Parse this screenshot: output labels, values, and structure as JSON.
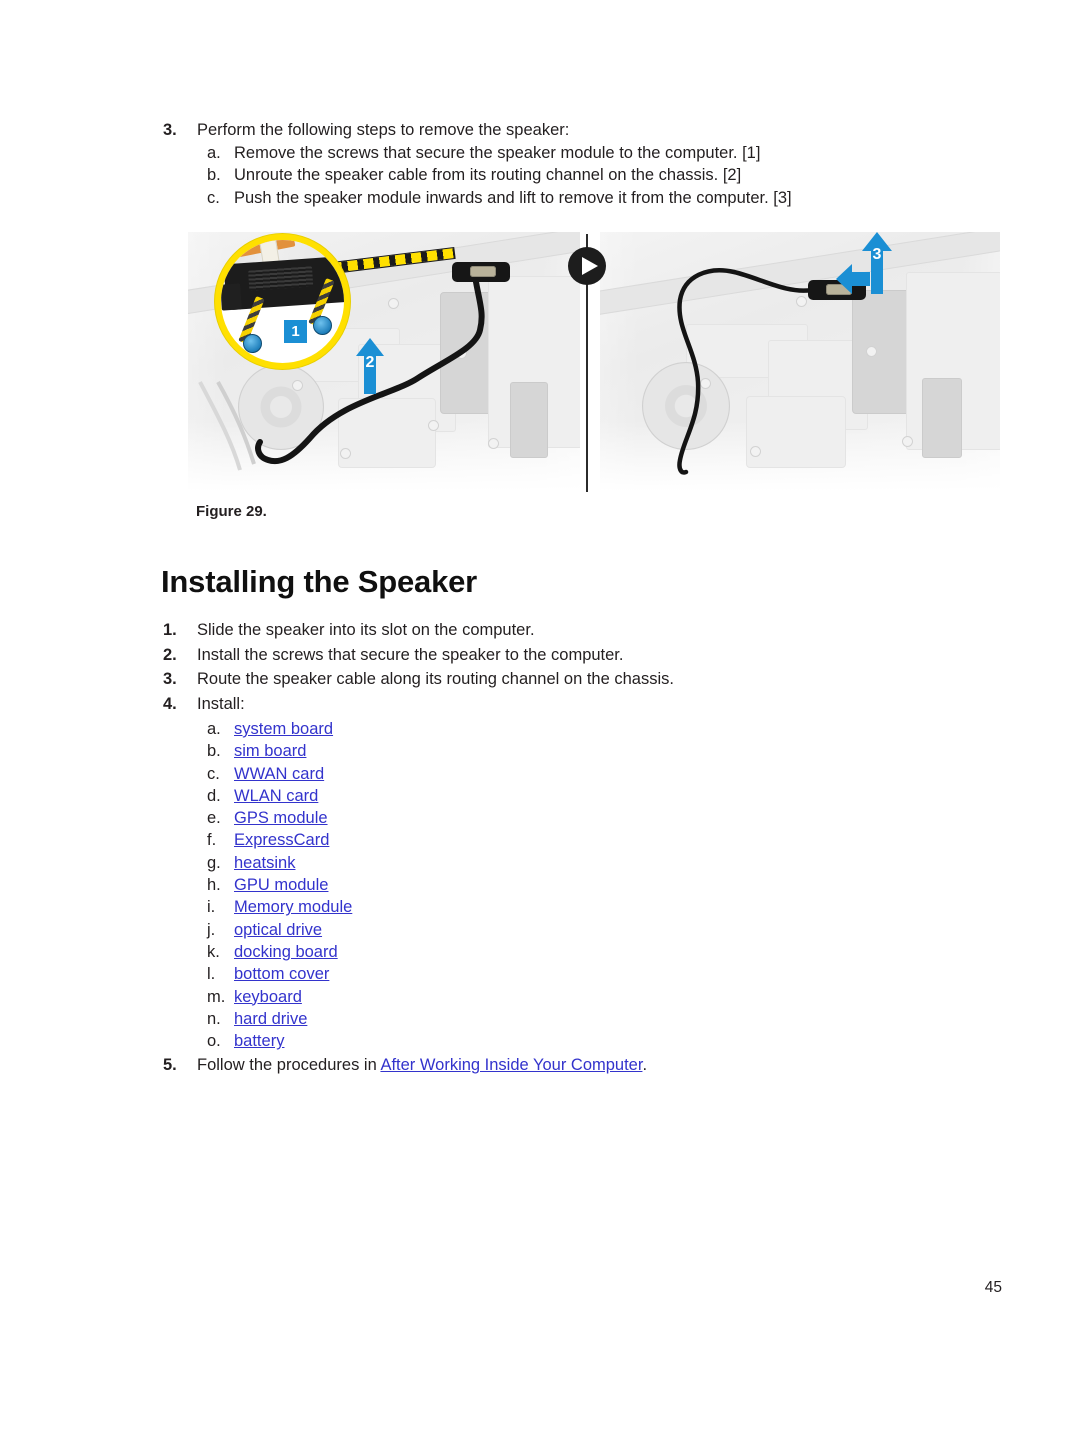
{
  "document": {
    "page_number": "45"
  },
  "removal_steps": {
    "number": "3.",
    "text": "Perform the following steps to remove the speaker:",
    "substeps": [
      {
        "letter": "a.",
        "text": "Remove the screws that secure the speaker module to the computer. [1]"
      },
      {
        "letter": "b.",
        "text": "Unroute the speaker cable from its routing channel on the chassis. [2]"
      },
      {
        "letter": "c.",
        "text": "Push the speaker module inwards and lift to remove it from the computer. [3]"
      }
    ]
  },
  "figure": {
    "caption": "Figure 29.",
    "callouts": [
      {
        "id": "1",
        "label": "1"
      },
      {
        "id": "2",
        "label": "2"
      },
      {
        "id": "3",
        "label": "3"
      }
    ],
    "divider_icon": "play-circle-icon"
  },
  "heading": "Installing the Speaker",
  "install_steps": [
    {
      "number": "1.",
      "text": "Slide the speaker into its slot on the computer."
    },
    {
      "number": "2.",
      "text": "Install the screws that secure the speaker to the computer."
    },
    {
      "number": "3.",
      "text": "Route the speaker cable along its routing channel on the chassis."
    },
    {
      "number": "4.",
      "text": "Install:"
    }
  ],
  "install_components": [
    {
      "letter": "a.",
      "label": "system board"
    },
    {
      "letter": "b.",
      "label": "sim board"
    },
    {
      "letter": "c.",
      "label": "WWAN card"
    },
    {
      "letter": "d.",
      "label": "WLAN card"
    },
    {
      "letter": "e.",
      "label": "GPS module"
    },
    {
      "letter": "f.",
      "label": "ExpressCard"
    },
    {
      "letter": "g.",
      "label": "heatsink"
    },
    {
      "letter": "h.",
      "label": "GPU module"
    },
    {
      "letter": "i.",
      "label": "Memory module"
    },
    {
      "letter": "j.",
      "label": "optical drive"
    },
    {
      "letter": "k.",
      "label": "docking board"
    },
    {
      "letter": "l.",
      "label": "bottom cover"
    },
    {
      "letter": "m.",
      "label": "keyboard"
    },
    {
      "letter": "n.",
      "label": "hard drive"
    },
    {
      "letter": "o.",
      "label": "battery"
    }
  ],
  "final_step": {
    "number": "5.",
    "prefix": "Follow the procedures in ",
    "link": "After Working Inside Your Computer",
    "suffix": "."
  },
  "colors": {
    "link": "#3333cc",
    "callout": "#1b8fd4",
    "magnifier": "#ffe000"
  }
}
